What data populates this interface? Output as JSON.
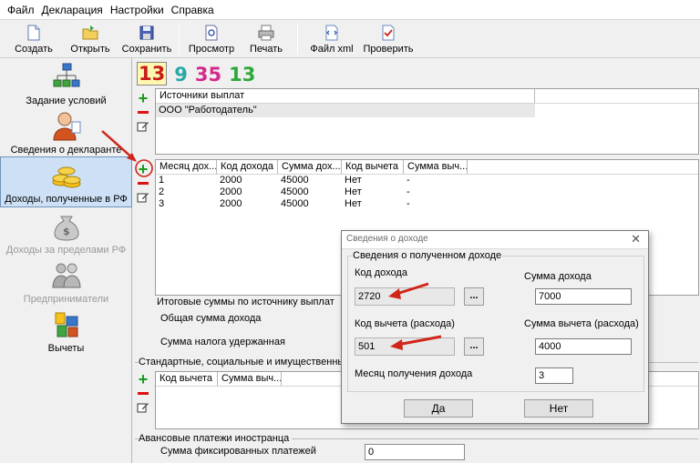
{
  "menu": [
    "Файл",
    "Декларация",
    "Настройки",
    "Справка"
  ],
  "toolbar": {
    "create": "Создать",
    "open": "Открыть",
    "save": "Сохранить",
    "preview": "Просмотр",
    "print": "Печать",
    "xml": "Файл xml",
    "check": "Проверить"
  },
  "nav": {
    "conditions": "Задание условий",
    "declarant": "Сведения о декларанте",
    "income_rf": "Доходы, полученные в РФ",
    "income_abroad": "Доходы за пределами РФ",
    "entrepreneurs": "Предприниматели",
    "deductions": "Вычеты"
  },
  "tax_rates": [
    "13",
    "9",
    "35",
    "13"
  ],
  "sources": {
    "header": "Источники выплат",
    "rows": [
      "ООО \"Работодатель\""
    ]
  },
  "income_table": {
    "columns": [
      "Месяц дох...",
      "Код дохода",
      "Сумма дох...",
      "Код вычета",
      "Сумма выч..."
    ],
    "rows": [
      [
        "1",
        "2000",
        "45000",
        "Нет",
        "-"
      ],
      [
        "2",
        "2000",
        "45000",
        "Нет",
        "-"
      ],
      [
        "3",
        "2000",
        "45000",
        "Нет",
        "-"
      ]
    ]
  },
  "totals": {
    "title": "Итоговые суммы по источнику выплат",
    "total_income": "Общая сумма дохода",
    "tax_withheld": "Сумма налога удержанная"
  },
  "deductions_section": {
    "title": "Стандартные, социальные и имущественные",
    "columns": [
      "Код вычета",
      "Сумма выч..."
    ]
  },
  "advance": {
    "title": "Авансовые платежи иностранца",
    "fixed_label": "Сумма фиксированных платежей",
    "fixed_value": "0"
  },
  "dialog": {
    "title": "Сведения о доходе",
    "group": "Сведения о полученном доходе",
    "income_code_label": "Код дохода",
    "income_code": "2720",
    "income_sum_label": "Сумма дохода",
    "income_sum": "7000",
    "deduction_code_label": "Код вычета (расхода)",
    "deduction_code": "501",
    "deduction_sum_label": "Сумма вычета (расхода)",
    "deduction_sum": "4000",
    "month_label": "Месяц получения дохода",
    "month": "3",
    "dots": "...",
    "yes": "Да",
    "no": "Нет",
    "close": "✕"
  },
  "colors": {
    "rate_13_sel": "#c81c1c",
    "rate_9": "#2aa8a8",
    "rate_35": "#d42a8c",
    "rate_13": "#2ea83a",
    "annotation_arrow": "#d0251a",
    "active_nav_bg": "#cde0f5"
  }
}
